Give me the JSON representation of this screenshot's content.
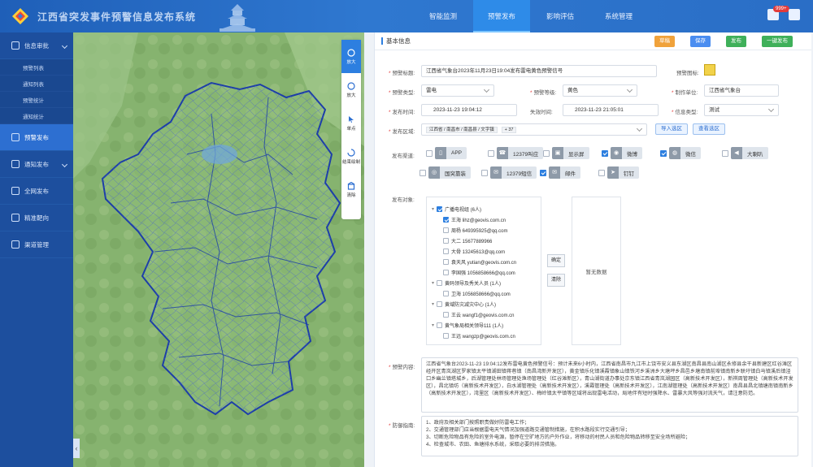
{
  "header": {
    "title": "江西省突发事件预警信息发布系统",
    "nav": [
      "智能监测",
      "预警发布",
      "影响评估",
      "系统管理"
    ],
    "active_nav": 1,
    "badge": "999+"
  },
  "sidebar": {
    "items": [
      {
        "label": "信息审批",
        "sub": [
          "预警列表",
          "通知列表",
          "预警统计",
          "通知统计"
        ]
      },
      {
        "label": "预警发布"
      },
      {
        "label": "通知发布"
      },
      {
        "label": "全网发布"
      },
      {
        "label": "精准靶向"
      },
      {
        "label": "渠道管理"
      }
    ]
  },
  "map_tools": [
    {
      "label": "放大"
    },
    {
      "label": "放大"
    },
    {
      "label": "单点"
    },
    {
      "label": "结束绘制"
    },
    {
      "label": "清除"
    }
  ],
  "panel": {
    "section_title": "基本信息",
    "buttons": {
      "draft": "草稿",
      "save": "保存",
      "publish": "发布",
      "one_click": "一键发布"
    },
    "labels": {
      "title": "预警标题:",
      "icon": "预警图标:",
      "type": "预警类型:",
      "level": "预警等级:",
      "unit": "制作单位:",
      "issue_time": "发布时间:",
      "expire_time": "失效时间:",
      "info_type": "信息类型:",
      "area": "发布区域:",
      "channels": "发布渠道:",
      "targets": "发布对象:",
      "content": "预警内容:",
      "guide": "防御指南:"
    },
    "values": {
      "title": "江西省气象台2023年11月23日19:04发布雷电黄色预警信号",
      "type": "雷电",
      "level": "黄色",
      "unit": "江西省气象台",
      "issue_time": "2023-11-23 19:04:12",
      "expire_time": "2023-11-23 21:05:01",
      "info_type": "测试",
      "area_tag": "江西省 / 南昌市 / 南昌县 / 文字镇",
      "area_more": "+ 37"
    },
    "area_buttons": {
      "import": "导入选区",
      "view": "查看选区"
    },
    "channels": [
      {
        "name": "APP",
        "checked": false,
        "icon": "app-icon",
        "glyph": "▯"
      },
      {
        "name": "12379叫应",
        "checked": false,
        "icon": "phone-icon",
        "glyph": "☎"
      },
      {
        "name": "显示屏",
        "checked": false,
        "icon": "display-icon",
        "glyph": "▣"
      },
      {
        "name": "微博",
        "checked": true,
        "icon": "weibo-icon",
        "glyph": "◉"
      },
      {
        "name": "微信",
        "checked": true,
        "icon": "wechat-icon",
        "glyph": "◍"
      },
      {
        "name": "大喇叭",
        "checked": false,
        "icon": "speaker-icon",
        "glyph": "◀"
      },
      {
        "name": "国突靠装",
        "checked": false,
        "icon": "target-icon",
        "glyph": "◎"
      },
      {
        "name": "12379短信",
        "checked": false,
        "icon": "sms-icon",
        "glyph": "✉"
      },
      {
        "name": "邮件",
        "checked": true,
        "icon": "mail-icon",
        "glyph": "✉"
      },
      {
        "name": "钉钉",
        "checked": false,
        "icon": "dingtalk-icon",
        "glyph": "➤"
      }
    ],
    "tree": [
      {
        "level": 0,
        "text": "广播电视组 (6人)",
        "checked": true,
        "expand": true
      },
      {
        "level": 1,
        "text": "王海 lihz@geovis.com.cn",
        "checked": true
      },
      {
        "level": 1,
        "text": "周杨 649395925@qq.com",
        "checked": false
      },
      {
        "level": 1,
        "text": "大二 15677889966",
        "checked": false
      },
      {
        "level": 1,
        "text": "大骨 13245613@qq.com",
        "checked": false
      },
      {
        "level": 1,
        "text": "袁天风 yutian@geovis.com.cn",
        "checked": false
      },
      {
        "level": 1,
        "text": "李国强 1056858666@qq.com",
        "checked": false
      },
      {
        "level": 0,
        "text": "黄码领导及秀关人员 (1人)",
        "checked": false,
        "expand": true
      },
      {
        "level": 1,
        "text": "卫海 1056858666@qq.com",
        "checked": false
      },
      {
        "level": 0,
        "text": "黄域防灾减灾中心 (1人)",
        "checked": false,
        "expand": true
      },
      {
        "level": 1,
        "text": "王云 wangf1@geovis.com.cn",
        "checked": false
      },
      {
        "level": 0,
        "text": "黄气象局相关领导111 (1人)",
        "checked": false,
        "expand": true
      },
      {
        "level": 1,
        "text": "王远 wangzp@geovis.com.cn",
        "checked": false
      }
    ],
    "tree_buttons": {
      "confirm": "确定",
      "clear": "清除"
    },
    "selected_placeholder": "暂无数据",
    "content_text": "江西省气象台2023-11-23 19:04:12发布雷电黄色预警信号：预计未来6小时内，江西省南昌市九江市上饶市安义县东湖区南昌县南山湖区永修县余干县新建区红谷滩区经开区青岚湖区罗家镇太平镇湖田镇蒋巷镇（南昌湾新开发区），黄金镇乐化镇溪霞镇象山镇铁河乡溪洲乡大塘坪乡昌邑乡塘南镇前埠镇南新乡联圩镇白马镇溪后镇泾口乡幽兰镇塔城乡，后湖管理处林场管理处渔场管理处（红谷滩新区），青山湖街道办事处京东镇江西省青岚湖园区（高新技术开发区），新祺周管理处（高新技术开发区），昌北镇坊（高新技术开发区），白水湖管理处（高新技术开发区），溪霞管理处（高新技术开发区），江南湖管理处（高新技术开发区）南昌县昌北镇塘南镇南新乡（高新技术开发区），湾里区（高新技术开发区）、梅岭镇太平镇等区域将出现雷电活动，局地伴有短时强降水、雷暴大风等强对流天气，请注意防范。",
    "guide_lines": [
      "1、政府及相关部门按照职责做好防雷电工作；",
      "2、交通管理部门应当根据雷电天气情况加强道路交通管制措施，在积水路段实行交通引导；",
      "3、切断危险物品有危险的室外电源，暂停在空旷地方的户外作业，将移动的村民人员和危险物品转移至安全场所避险；",
      "4、检查城市、农田、鱼塘排水系统，采取必要的排涝措施。"
    ]
  },
  "colors": {
    "primary": "#2d7fe0",
    "sidebar": "#1d4f9e",
    "topbar": "#2a6ec6",
    "draft": "#f0a23b",
    "save": "#4a8df0",
    "publish": "#3fb05a"
  }
}
